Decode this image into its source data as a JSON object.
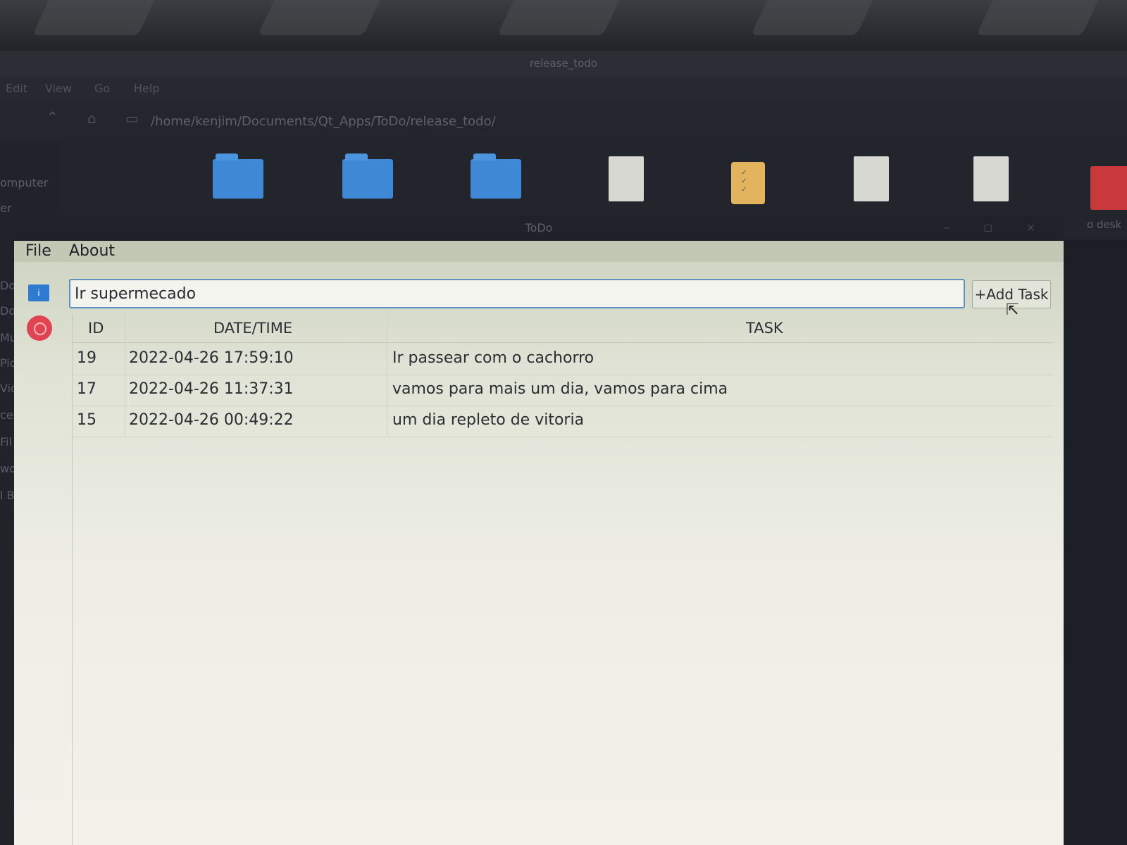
{
  "file_manager": {
    "title": "release_todo",
    "menu": [
      "Edit",
      "View",
      "Go",
      "Help"
    ],
    "path": "/home/kenjim/Documents/Qt_Apps/ToDo/release_todo/",
    "sidebar": [
      "omputer",
      "er",
      "Do",
      "Do",
      "Mu",
      "Pic",
      "Vid",
      "ces",
      "Fil",
      "wor",
      "l Bro"
    ],
    "desktop_label": "o desk"
  },
  "window": {
    "title": "ToDo",
    "controls": "– ◻ ×"
  },
  "menubar": {
    "file": "File",
    "about": "About"
  },
  "input": {
    "value": "Ir supermecado"
  },
  "add_button": {
    "label": "+Add Task"
  },
  "table": {
    "headers": {
      "id": "ID",
      "datetime": "DATE/TIME",
      "task": "TASK"
    },
    "rows": [
      {
        "id": "19",
        "datetime": "2022-04-26 17:59:10",
        "task": "Ir passear com o cachorro"
      },
      {
        "id": "17",
        "datetime": "2022-04-26 11:37:31",
        "task": "vamos para mais um dia, vamos para cima"
      },
      {
        "id": "15",
        "datetime": "2022-04-26 00:49:22",
        "task": "um dia repleto de vitoria"
      }
    ]
  },
  "colors": {
    "accent_blue": "#2f7bd0",
    "stop_red": "#e04450",
    "folder_blue": "#3f88d6",
    "window_bg": "#eeeee6"
  }
}
